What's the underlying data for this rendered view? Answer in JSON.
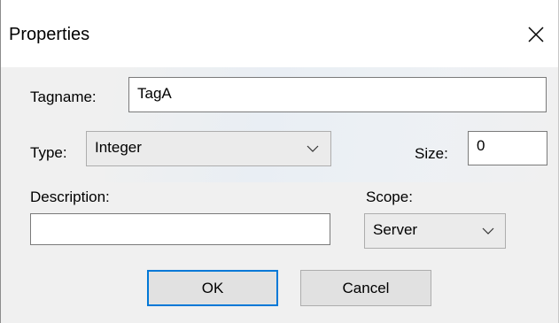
{
  "dialog": {
    "title": "Properties"
  },
  "tagname": {
    "label": "Tagname:",
    "value": "TagA"
  },
  "type": {
    "label": "Type:",
    "selected": "Integer"
  },
  "size": {
    "label": "Size:",
    "value": "0"
  },
  "description": {
    "label": "Description:",
    "value": ""
  },
  "scope": {
    "label": "Scope:",
    "selected": "Server"
  },
  "buttons": {
    "ok_label": "OK",
    "cancel_label": "Cancel"
  },
  "icons": {
    "close": "close-icon",
    "dropdown": "chevron-down-icon"
  },
  "colors": {
    "accent": "#0078d7",
    "client_bg": "#f0f0f0",
    "button_bg": "#e1e1e1"
  }
}
